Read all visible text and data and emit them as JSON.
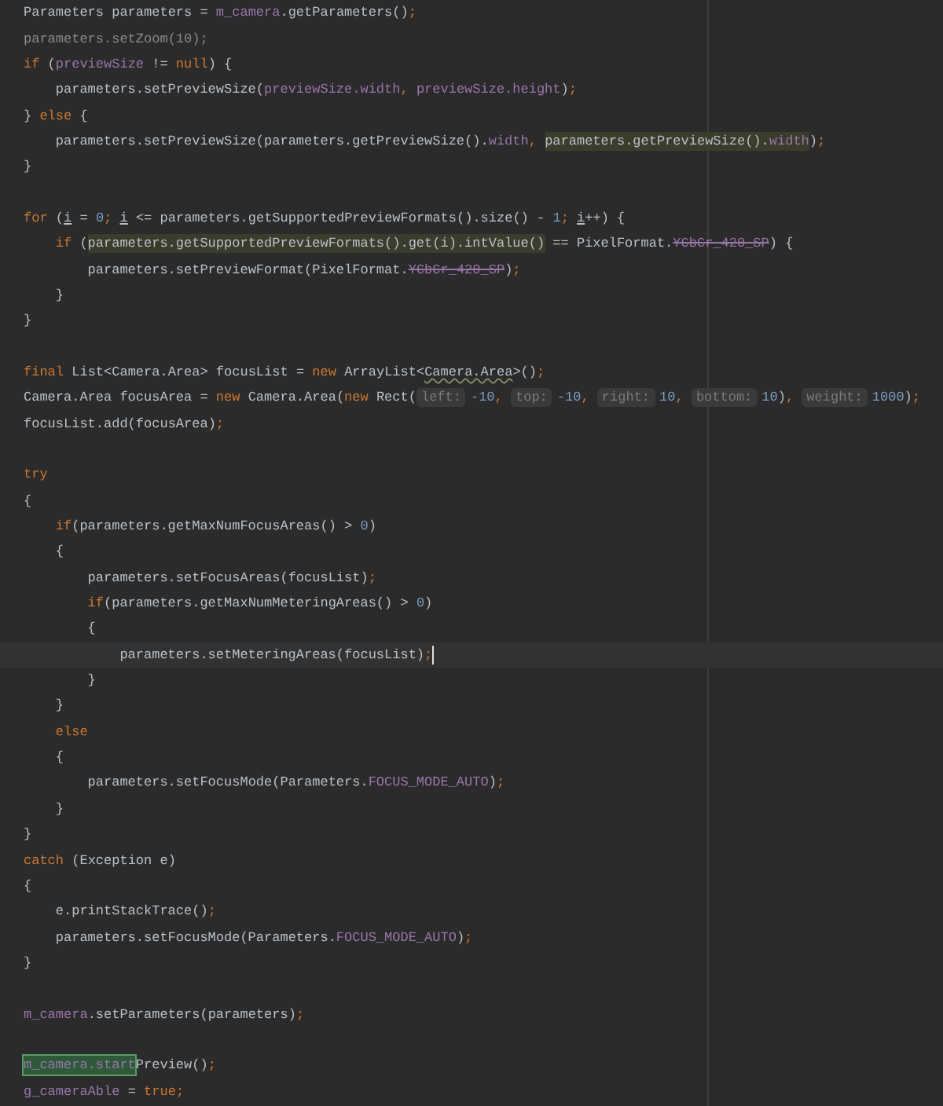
{
  "editor": {
    "lines": [
      {
        "current": false,
        "tokens": [
          {
            "kind": "plain",
            "text": "Parameters parameters = "
          },
          {
            "kind": "field",
            "text": "m_camera"
          },
          {
            "kind": "plain",
            "text": ".getParameters()"
          },
          {
            "kind": "keyword",
            "text": ";"
          }
        ]
      },
      {
        "current": false,
        "tokens": [
          {
            "kind": "unused",
            "text": "parameters.setZoom(10);"
          }
        ]
      },
      {
        "current": false,
        "tokens": [
          {
            "kind": "keyword",
            "text": "if"
          },
          {
            "kind": "plain",
            "text": " ("
          },
          {
            "kind": "field",
            "text": "previewSize"
          },
          {
            "kind": "plain",
            "text": " != "
          },
          {
            "kind": "keyword",
            "text": "null"
          },
          {
            "kind": "plain",
            "text": ") {"
          }
        ],
        "children": [
          {
            "current": false,
            "tokens": [
              {
                "kind": "plain",
                "text": "parameters.setPreviewSize("
              },
              {
                "kind": "field",
                "text": "previewSize.width"
              },
              {
                "kind": "keyword",
                "text": ", "
              },
              {
                "kind": "field",
                "text": "previewSize.height"
              },
              {
                "kind": "plain",
                "text": ")"
              },
              {
                "kind": "keyword",
                "text": ";"
              }
            ]
          }
        ]
      },
      {
        "current": false,
        "tokens": [
          {
            "kind": "plain",
            "text": "} "
          },
          {
            "kind": "keyword",
            "text": "else"
          },
          {
            "kind": "plain",
            "text": " {"
          }
        ],
        "children": [
          {
            "current": false,
            "tokens": [
              {
                "kind": "plain",
                "text": "parameters.setPreviewSize(parameters.getPreviewSize()."
              },
              {
                "kind": "field",
                "text": "width"
              },
              {
                "kind": "keyword",
                "text": ", "
              },
              {
                "kind": "match",
                "text": "parameters.getPreviewSize()."
              },
              {
                "kind": "match_field",
                "text": "width"
              },
              {
                "kind": "plain",
                "text": ")"
              },
              {
                "kind": "keyword",
                "text": ";"
              }
            ]
          }
        ]
      },
      {
        "current": false,
        "tokens": [
          {
            "kind": "plain",
            "text": "}"
          }
        ]
      },
      {
        "current": false
      },
      {
        "current": false,
        "tokens": [
          {
            "kind": "keyword",
            "text": "for"
          },
          {
            "kind": "plain",
            "text": " ("
          },
          {
            "kind": "underlined",
            "text": "i"
          },
          {
            "kind": "plain",
            "text": " = "
          },
          {
            "kind": "number",
            "text": "0"
          },
          {
            "kind": "keyword",
            "text": "; "
          },
          {
            "kind": "underlined",
            "text": "i"
          },
          {
            "kind": "plain",
            "text": " <= parameters.getSupportedPreviewFormats().size() - "
          },
          {
            "kind": "number",
            "text": "1"
          },
          {
            "kind": "keyword",
            "text": "; "
          },
          {
            "kind": "underlined",
            "text": "i"
          },
          {
            "kind": "plain",
            "text": "++) {"
          }
        ],
        "children": [
          {
            "current": false,
            "tokens": [
              {
                "kind": "keyword",
                "text": "if"
              },
              {
                "kind": "plain",
                "text": " ("
              },
              {
                "kind": "match",
                "text": "parameters.getSupportedPreviewFormats().get(i).intValue()"
              },
              {
                "kind": "plain",
                "text": " == PixelFormat."
              },
              {
                "kind": "struck",
                "text": "YCbCr_420_SP"
              },
              {
                "kind": "plain",
                "text": ") {"
              }
            ],
            "children": [
              {
                "current": false,
                "tokens": [
                  {
                    "kind": "plain",
                    "text": "parameters.setPreviewFormat(PixelFormat."
                  },
                  {
                    "kind": "struck",
                    "text": "YCbCr_420_SP"
                  },
                  {
                    "kind": "plain",
                    "text": ")"
                  },
                  {
                    "kind": "keyword",
                    "text": ";"
                  }
                ]
              }
            ]
          },
          {
            "current": false,
            "tokens": [
              {
                "kind": "plain",
                "text": "}"
              }
            ]
          }
        ]
      },
      {
        "current": false,
        "tokens": [
          {
            "kind": "plain",
            "text": "}"
          }
        ]
      },
      {
        "current": false
      },
      {
        "current": false,
        "tokens": [
          {
            "kind": "keyword",
            "text": "final"
          },
          {
            "kind": "plain",
            "text": " List<Camera.Area> focusList = "
          },
          {
            "kind": "keyword",
            "text": "new"
          },
          {
            "kind": "plain",
            "text": " ArrayList<"
          },
          {
            "kind": "wavy",
            "text": "Camera.Area"
          },
          {
            "kind": "plain",
            "text": ">()"
          },
          {
            "kind": "keyword",
            "text": ";"
          }
        ]
      },
      {
        "current": false,
        "tokens": [
          {
            "kind": "plain",
            "text": "Camera.Area focusArea = "
          },
          {
            "kind": "keyword",
            "text": "new"
          },
          {
            "kind": "plain",
            "text": " Camera.Area("
          },
          {
            "kind": "keyword",
            "text": "new"
          },
          {
            "kind": "plain",
            "text": " Rect("
          },
          {
            "kind": "hint",
            "text": "left:"
          },
          {
            "kind": "number",
            "text": "-10"
          },
          {
            "kind": "keyword",
            "text": ", "
          },
          {
            "kind": "hint",
            "text": "top:"
          },
          {
            "kind": "number",
            "text": "-10"
          },
          {
            "kind": "keyword",
            "text": ", "
          },
          {
            "kind": "hint",
            "text": "right:"
          },
          {
            "kind": "number",
            "text": "10"
          },
          {
            "kind": "keyword",
            "text": ", "
          },
          {
            "kind": "hint",
            "text": "bottom:"
          },
          {
            "kind": "number",
            "text": "10"
          },
          {
            "kind": "plain",
            "text": ")"
          },
          {
            "kind": "keyword",
            "text": ", "
          },
          {
            "kind": "hint",
            "text": "weight:"
          },
          {
            "kind": "number",
            "text": "1000"
          },
          {
            "kind": "plain",
            "text": ")"
          },
          {
            "kind": "keyword",
            "text": ";"
          }
        ]
      },
      {
        "current": false,
        "tokens": [
          {
            "kind": "plain",
            "text": "focusList.add(focusArea)"
          },
          {
            "kind": "keyword",
            "text": ";"
          }
        ]
      },
      {
        "current": false
      },
      {
        "current": false,
        "tokens": [
          {
            "kind": "keyword",
            "text": "try"
          }
        ]
      },
      {
        "current": false,
        "tokens": [
          {
            "kind": "plain",
            "text": "{"
          }
        ],
        "children": [
          {
            "current": false,
            "tokens": [
              {
                "kind": "keyword",
                "text": "if"
              },
              {
                "kind": "plain",
                "text": "(parameters.getMaxNumFocusAreas() > "
              },
              {
                "kind": "number",
                "text": "0"
              },
              {
                "kind": "plain",
                "text": ")"
              }
            ]
          },
          {
            "current": false,
            "tokens": [
              {
                "kind": "plain",
                "text": "{"
              }
            ],
            "children": [
              {
                "current": false,
                "tokens": [
                  {
                    "kind": "plain",
                    "text": "parameters.setFocusAreas(focusList)"
                  },
                  {
                    "kind": "keyword",
                    "text": ";"
                  }
                ]
              },
              {
                "current": false,
                "tokens": [
                  {
                    "kind": "keyword",
                    "text": "if"
                  },
                  {
                    "kind": "plain",
                    "text": "(parameters.getMaxNumMeteringAreas() > "
                  },
                  {
                    "kind": "number",
                    "text": "0"
                  },
                  {
                    "kind": "plain",
                    "text": ")"
                  }
                ]
              },
              {
                "current": false,
                "tokens": [
                  {
                    "kind": "plain",
                    "text": "{"
                  }
                ],
                "children": [
                  {
                    "current": true,
                    "tokens": [
                      {
                        "kind": "plain",
                        "text": "parameters.setMeteringAreas(focusList)"
                      },
                      {
                        "kind": "keyword",
                        "text": ";"
                      }
                    ]
                  }
                ]
              },
              {
                "current": false,
                "tokens": [
                  {
                    "kind": "plain",
                    "text": "}"
                  }
                ]
              }
            ]
          },
          {
            "current": false,
            "tokens": [
              {
                "kind": "plain",
                "text": "}"
              }
            ]
          },
          {
            "current": false,
            "tokens": [
              {
                "kind": "keyword",
                "text": "else"
              }
            ]
          },
          {
            "current": false,
            "tokens": [
              {
                "kind": "plain",
                "text": "{"
              }
            ],
            "children": [
              {
                "current": false,
                "tokens": [
                  {
                    "kind": "plain",
                    "text": "parameters.setFocusMode(Parameters."
                  },
                  {
                    "kind": "field",
                    "text": "FOCUS_MODE_AUTO"
                  },
                  {
                    "kind": "plain",
                    "text": ")"
                  },
                  {
                    "kind": "keyword",
                    "text": ";"
                  }
                ]
              }
            ]
          },
          {
            "current": false,
            "tokens": [
              {
                "kind": "plain",
                "text": "}"
              }
            ]
          }
        ]
      },
      {
        "current": false,
        "tokens": [
          {
            "kind": "plain",
            "text": "}"
          }
        ]
      },
      {
        "current": false,
        "tokens": [
          {
            "kind": "keyword",
            "text": "catch"
          },
          {
            "kind": "plain",
            "text": " (Exception e)"
          }
        ]
      },
      {
        "current": false,
        "tokens": [
          {
            "kind": "plain",
            "text": "{"
          }
        ],
        "children": [
          {
            "current": false,
            "tokens": [
              {
                "kind": "plain",
                "text": "e.printStackTrace()"
              },
              {
                "kind": "keyword",
                "text": ";"
              }
            ]
          },
          {
            "current": false,
            "tokens": [
              {
                "kind": "plain",
                "text": "parameters.setFocusMode(Parameters."
              },
              {
                "kind": "field",
                "text": "FOCUS_MODE_AUTO"
              },
              {
                "kind": "plain",
                "text": ")"
              },
              {
                "kind": "keyword",
                "text": ";"
              }
            ]
          }
        ]
      },
      {
        "current": false,
        "tokens": [
          {
            "kind": "plain",
            "text": "}"
          }
        ]
      },
      {
        "current": false
      },
      {
        "current": false,
        "tokens": [
          {
            "kind": "field",
            "text": "m_camera"
          },
          {
            "kind": "plain",
            "text": ".setParameters(parameters)"
          },
          {
            "kind": "keyword",
            "text": ";"
          }
        ]
      },
      {
        "current": false
      },
      {
        "current": false,
        "tokens": [
          {
            "kind": "found",
            "text": "m_camera.start"
          },
          {
            "kind": "plain",
            "text": "Preview()"
          },
          {
            "kind": "keyword",
            "text": ";"
          }
        ]
      },
      {
        "current": false,
        "tokens": [
          {
            "kind": "field",
            "text": "g_cameraAble"
          },
          {
            "kind": "plain",
            "text": " = "
          },
          {
            "kind": "keyword",
            "text": "true"
          },
          {
            "kind": "keyword",
            "text": ";"
          }
        ]
      }
    ]
  }
}
